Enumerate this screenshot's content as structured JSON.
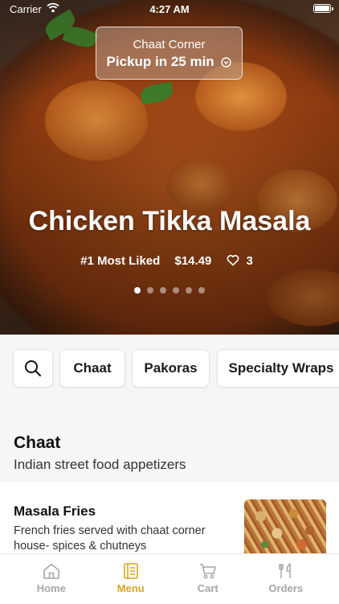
{
  "status_bar": {
    "carrier": "Carrier",
    "time": "4:27 AM"
  },
  "pickup": {
    "store_name": "Chaat Corner",
    "eta": "Pickup in 25 min"
  },
  "featured": {
    "title": "Chicken Tikka Masala",
    "badge": "#1 Most Liked",
    "price": "$14.49",
    "likes": "3",
    "carousel_count": 6,
    "carousel_active_index": 0
  },
  "categories": [
    "Chaat",
    "Pakoras",
    "Specialty Wraps"
  ],
  "section": {
    "title": "Chaat",
    "subtitle": "Indian street food appetizers"
  },
  "menu_item": {
    "name": "Masala Fries",
    "description": "French fries served with chaat corner house- spices & chutneys"
  },
  "tabs": [
    {
      "label": "Home",
      "icon": "home-icon",
      "active": false
    },
    {
      "label": "Menu",
      "icon": "menu-icon",
      "active": true
    },
    {
      "label": "Cart",
      "icon": "cart-icon",
      "active": false
    },
    {
      "label": "Orders",
      "icon": "orders-icon",
      "active": false
    }
  ],
  "colors": {
    "accent": "#d9a521",
    "inactive_tab": "#a6a6a6"
  }
}
